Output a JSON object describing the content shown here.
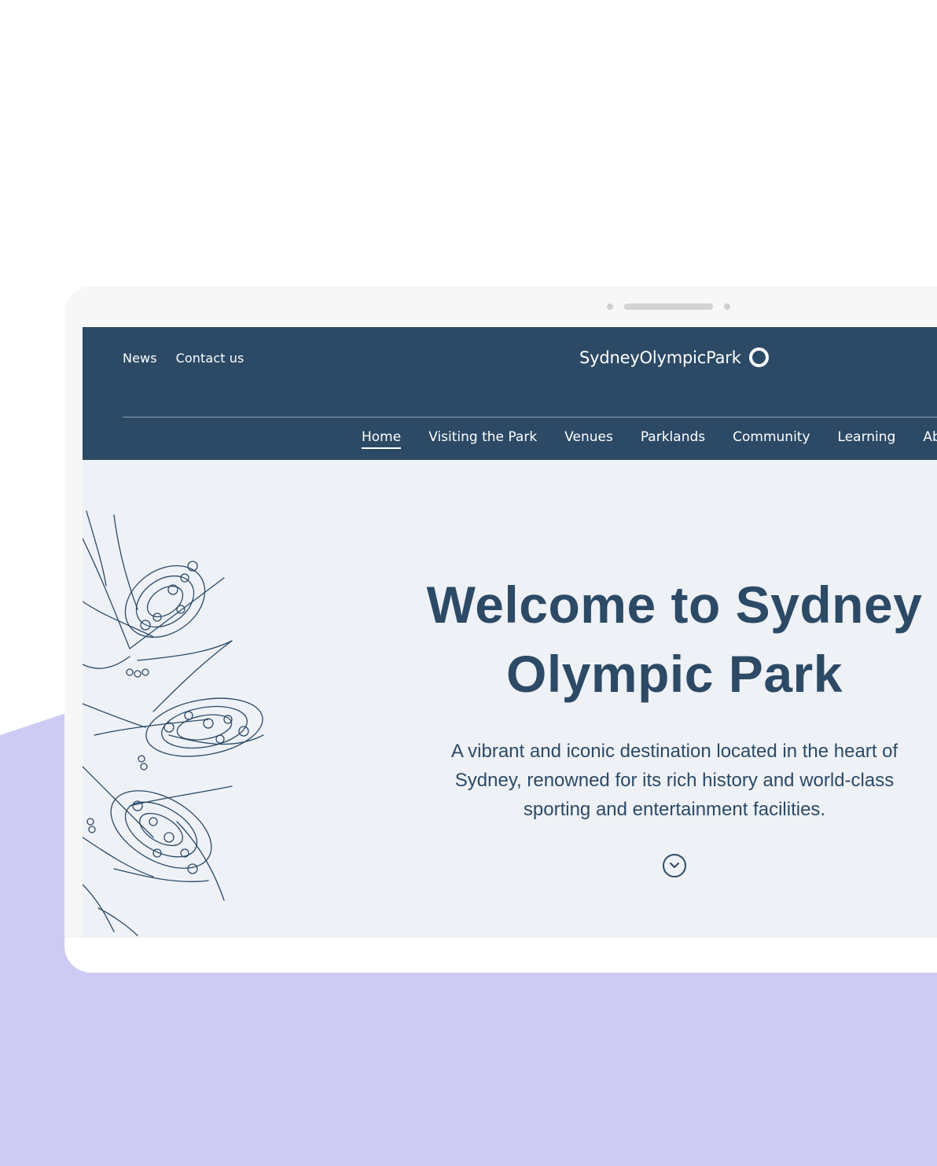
{
  "page": {
    "background": "#ffffff",
    "accent_blob_color": "#cdcbf3"
  },
  "header": {
    "background": "#2c4a66",
    "utility_links": [
      "News",
      "Contact us"
    ],
    "logo_text": "SydneyOlympicPark"
  },
  "nav": {
    "items": [
      "Home",
      "Visiting the Park",
      "Venues",
      "Parklands",
      "Community",
      "Learning",
      "About"
    ],
    "active": "Home"
  },
  "hero": {
    "title": "Welcome to Sydney Olympic Park",
    "subtitle": "A vibrant and iconic destination located in the heart of Sydney, renowned for its rich history and world-class sporting and entertainment facilities.",
    "scroll_icon": "chevron-down-circle-icon",
    "illustration": "grevillea-flower-illustration",
    "background": "#eef1f6"
  }
}
